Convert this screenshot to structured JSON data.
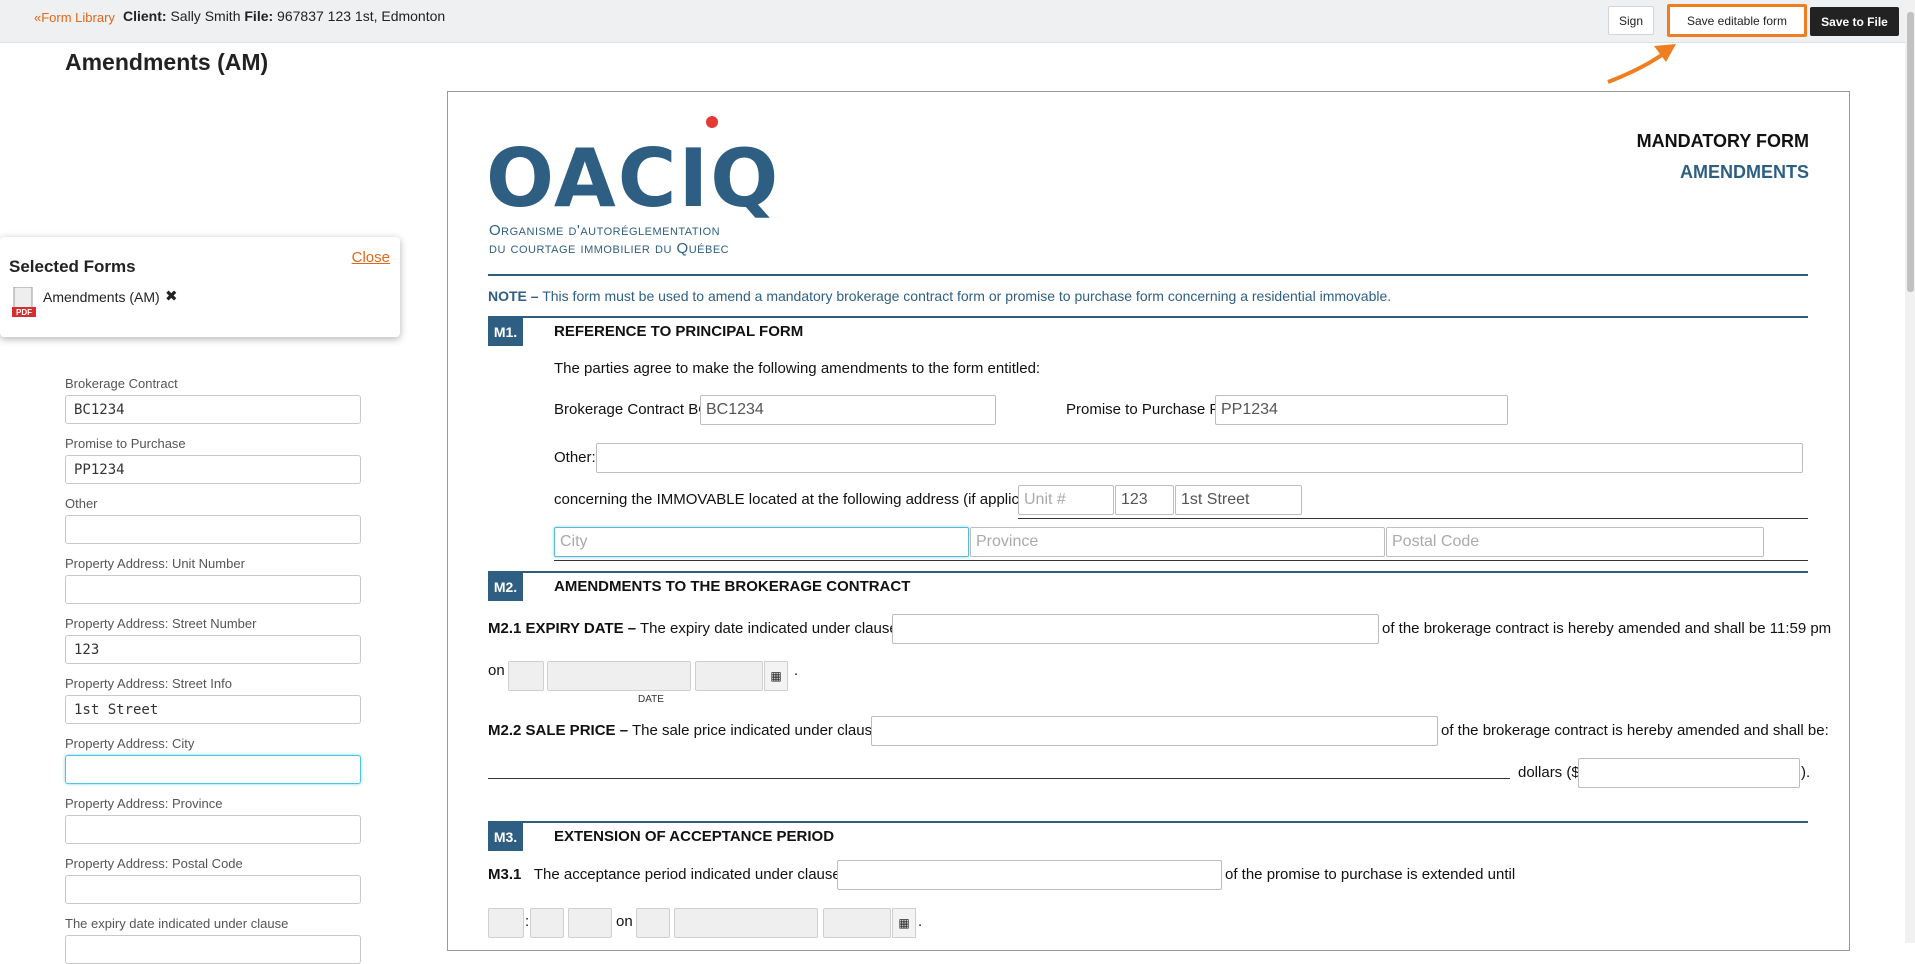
{
  "topbar": {
    "form_library": "«Form Library",
    "client_label": "Client:",
    "client_name": "Sally Smith",
    "file_label": "File:",
    "file_value": "967837 123 1st, Edmonton",
    "sign_label": "Sign",
    "save_editable_label": "Save editable form",
    "save_file_label": "Save to File",
    "highlight_color": "#f07d1f"
  },
  "page_title": "Amendments (AM)",
  "selected_forms": {
    "title": "Selected Forms",
    "close_label": "Close",
    "items": [
      {
        "name": "Amendments (AM)",
        "remove": "✖"
      }
    ]
  },
  "sidebar_fields": [
    {
      "label": "Brokerage Contract",
      "value": "BC1234"
    },
    {
      "label": "Promise to Purchase",
      "value": "PP1234"
    },
    {
      "label": "Other",
      "value": ""
    },
    {
      "label": "Property Address: Unit Number",
      "value": ""
    },
    {
      "label": "Property Address: Street Number",
      "value": "123"
    },
    {
      "label": "Property Address: Street Info",
      "value": "1st Street"
    },
    {
      "label": "Property Address: City",
      "value": ""
    },
    {
      "label": "Property Address: Province",
      "value": ""
    },
    {
      "label": "Property Address: Postal Code",
      "value": ""
    },
    {
      "label": "The expiry date indicated under clause",
      "value": ""
    }
  ],
  "doc": {
    "logo_text": "OACIQ",
    "logo_sub1": "Organisme d'autoréglementation",
    "logo_sub2": "du courtage immobilier du Québec",
    "mandatory": "MANDATORY FORM",
    "amendments": "AMENDMENTS",
    "note_bold": "NOTE –",
    "note_text": " This form must be used to amend a mandatory brokerage contract form or promise to purchase form concerning a residential immovable.",
    "m1": {
      "code": "M1.",
      "title": "REFERENCE TO PRINCIPAL FORM",
      "intro": "The parties agree to make the following amendments to the form entitled:",
      "bc_label": "Brokerage Contract BC",
      "bc_value": "BC1234",
      "pp_label": "Promise to Purchase PP",
      "pp_value": "PP1234",
      "other_label": "Other:",
      "address_label": "concerning the IMMOVABLE located at the following address (if applicable):",
      "unit_placeholder": "Unit #",
      "street_number": "123",
      "street_info": "1st Street",
      "city_placeholder": "City",
      "province_placeholder": "Province",
      "postal_placeholder": "Postal Code"
    },
    "m2": {
      "code": "M2.",
      "title": "AMENDMENTS TO THE BROKERAGE CONTRACT",
      "m21_bold": "M2.1 EXPIRY DATE  –",
      "m21_text": "The expiry date indicated under clause",
      "m21_after": "of the brokerage contract is hereby amended and shall be 11:59 pm",
      "on_label": "on",
      "date_label": "DATE",
      "period": ".",
      "m22_bold": "M2.2 SALE PRICE  –",
      "m22_text": "The sale price indicated under clause",
      "m22_after": "of the brokerage contract is hereby amended and shall be:",
      "dollars_label": "dollars ($",
      "close_paren": ")."
    },
    "m3": {
      "code": "M3.",
      "title": "EXTENSION OF ACCEPTANCE PERIOD",
      "m31_bold": "M3.1",
      "m31_text": "The acceptance period indicated under clause",
      "m31_after": "of the promise to purchase is extended until",
      "colon": ":",
      "on_label": "on",
      "period": "."
    }
  }
}
